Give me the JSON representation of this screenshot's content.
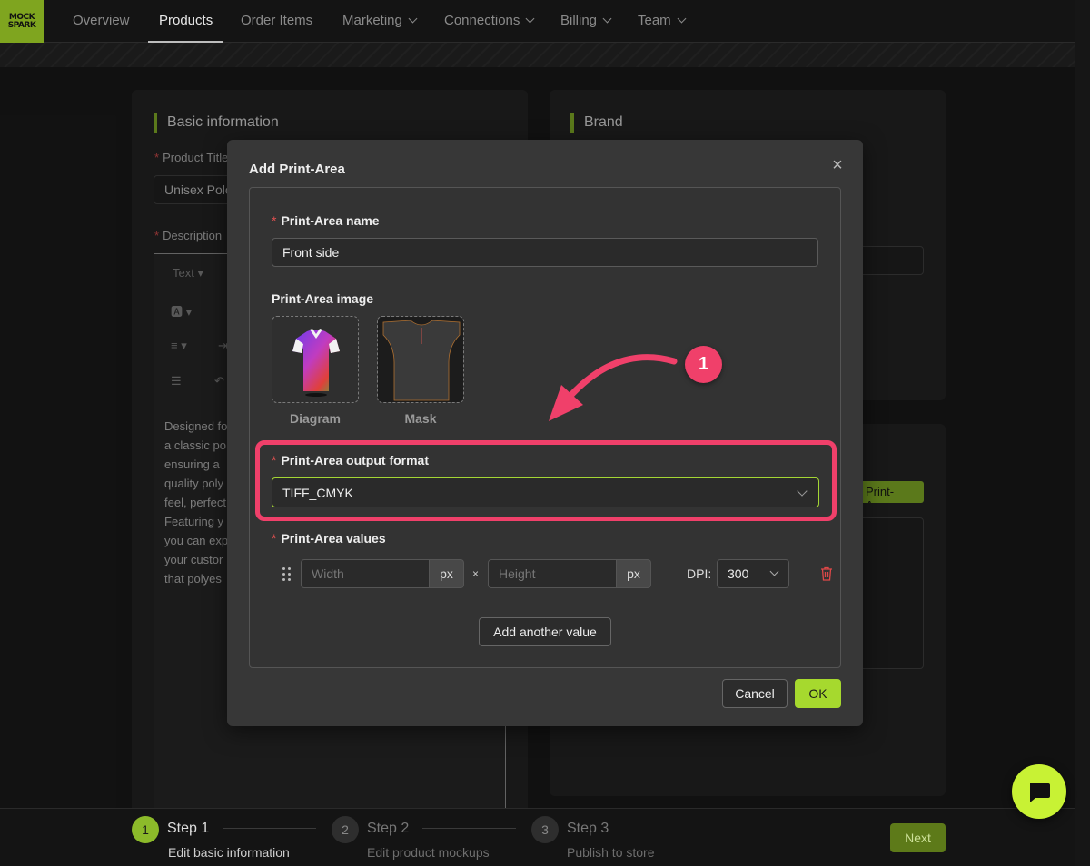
{
  "brand": {
    "logo_text": "MOCK SPARK"
  },
  "nav": {
    "items": [
      {
        "label": "Overview"
      },
      {
        "label": "Products"
      },
      {
        "label": "Order Items"
      },
      {
        "label": "Marketing"
      },
      {
        "label": "Connections"
      },
      {
        "label": "Billing"
      },
      {
        "label": "Team"
      }
    ],
    "active": "Products"
  },
  "basic_info": {
    "title": "Basic information",
    "product_title_label": "Product Title",
    "product_title_value": "Unisex Polo",
    "description_label": "Description",
    "toolbar_text": "Text",
    "description_lines": [
      "Designed fo",
      "a classic po",
      "ensuring a",
      "quality poly",
      "feel, perfect",
      "Featuring y",
      "you can exp",
      "your custor",
      "that polyes"
    ]
  },
  "brand_panel": {
    "title": "Brand",
    "print_area_tag": "Print-Area"
  },
  "modal": {
    "title": "Add Print-Area",
    "close": "×",
    "name_label": "Print-Area name",
    "name_value": "Front side",
    "image_label": "Print-Area image",
    "diagram_caption": "Diagram",
    "mask_caption": "Mask",
    "format_label": "Print-Area output format",
    "format_value": "TIFF_CMYK",
    "values_label": "Print-Area values",
    "width_placeholder": "Width",
    "height_placeholder": "Height",
    "unit": "px",
    "times": "×",
    "dpi_label": "DPI:",
    "dpi_value": "300",
    "add_value_button": "Add another value",
    "cancel_button": "Cancel",
    "ok_button": "OK"
  },
  "annotation": {
    "step_number": "1",
    "color": "#f0406a"
  },
  "steps": [
    {
      "number": "1",
      "title": "Step 1",
      "desc": "Edit basic information"
    },
    {
      "number": "2",
      "title": "Step 2",
      "desc": "Edit product mockups"
    },
    {
      "number": "3",
      "title": "Step 3",
      "desc": "Publish to store"
    }
  ],
  "footer": {
    "next_button": "Next"
  },
  "colors": {
    "accent": "#a6d92e",
    "highlight": "#f0406a",
    "background": "#1b1b1b"
  }
}
